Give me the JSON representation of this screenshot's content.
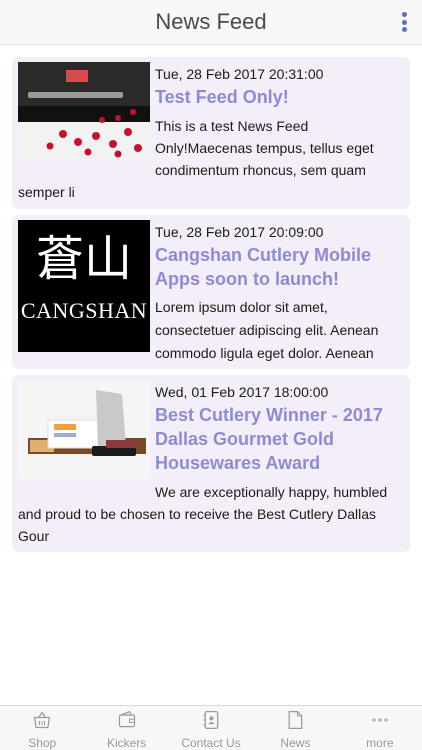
{
  "header": {
    "title": "News Feed"
  },
  "colors": {
    "accent": "#8e8ad6",
    "card_bg": "#f4eef9",
    "menu_dots": "#5b6fc4"
  },
  "feed": [
    {
      "date": "Tue, 28 Feb 2017 20:31:00",
      "title": "Test Feed Only!",
      "excerpt_lines": [
        "This is a test News Feed",
        "Only!Maecenas tempus, tellus eget",
        "condimentum rhoncus, sem quam",
        "semper li"
      ],
      "image": "knife-box-with-hearts"
    },
    {
      "date": "Tue, 28 Feb 2017 20:09:00",
      "title_lines": [
        "Cangshan Cutlery Mobile",
        "Apps soon to launch!"
      ],
      "excerpt_lines": [
        "Lorem ipsum dolor sit amet,",
        "consectetuer adipiscing elit. Aenean",
        "commodo ligula eget dolor. Aenean"
      ],
      "logo": {
        "chinese": "蒼山",
        "wordmark": "CANGSHAN"
      }
    },
    {
      "date": "Wed, 01 Feb 2017 18:00:00",
      "title_lines": [
        "Best Cutlery Winner - 2017",
        "Dallas Gourmet Gold",
        "Housewares Award"
      ],
      "excerpt_lines": [
        "We are exceptionally happy, humbled",
        "and proud to be chosen to receive the Best Cutlery Dallas",
        "Gour"
      ],
      "image": "cleaver-with-award-box"
    }
  ],
  "tabbar": {
    "items": [
      {
        "label": "Shop",
        "icon": "basket-icon"
      },
      {
        "label": "Kickers",
        "icon": "wallet-icon"
      },
      {
        "label": "Contact Us",
        "icon": "contacts-book-icon"
      },
      {
        "label": "News",
        "icon": "document-icon"
      },
      {
        "label": "more",
        "icon": "more-dots-icon"
      }
    ]
  }
}
